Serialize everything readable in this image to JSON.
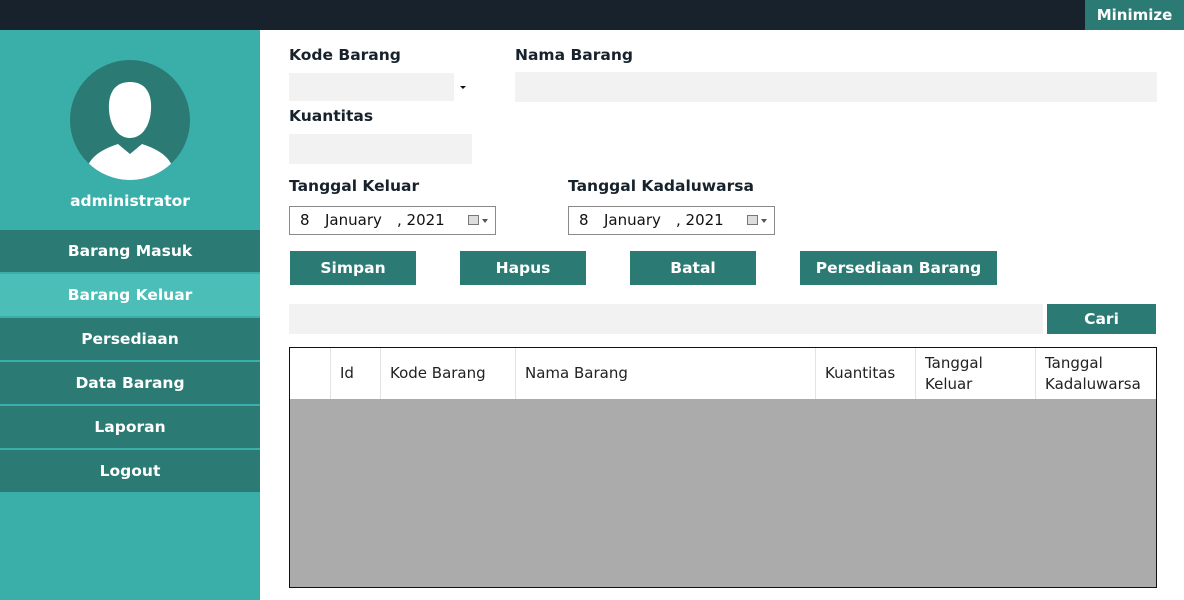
{
  "window": {
    "minimize_label": "Minimize"
  },
  "sidebar": {
    "username": "administrator",
    "items": [
      {
        "label": "Barang Masuk"
      },
      {
        "label": "Barang Keluar",
        "active": true
      },
      {
        "label": "Persediaan"
      },
      {
        "label": "Data Barang"
      },
      {
        "label": "Laporan"
      },
      {
        "label": "Logout"
      }
    ]
  },
  "form": {
    "kode_barang_label": "Kode Barang",
    "kode_barang_value": "",
    "nama_barang_label": "Nama Barang",
    "nama_barang_value": "",
    "kuantitas_label": "Kuantitas",
    "kuantitas_value": "",
    "tanggal_keluar_label": "Tanggal Keluar",
    "tanggal_keluar": {
      "day": "8",
      "month": "January",
      "year": ", 2021"
    },
    "tanggal_kadaluwarsa_label": "Tanggal Kadaluwarsa",
    "tanggal_kadaluwarsa": {
      "day": "8",
      "month": "January",
      "year": ", 2021"
    }
  },
  "buttons": {
    "simpan": "Simpan",
    "hapus": "Hapus",
    "batal": "Batal",
    "persediaan_barang": "Persediaan Barang",
    "cari": "Cari"
  },
  "search": {
    "value": ""
  },
  "table": {
    "columns": [
      "",
      "Id",
      "Kode Barang",
      "Nama Barang",
      "Kuantitas",
      "Tanggal Keluar",
      "Tanggal Kadaluwarsa"
    ],
    "rows": []
  },
  "colors": {
    "topbar": "#17222c",
    "sidebar": "#3aafa9",
    "accent": "#2b7a73",
    "active_nav": "#4bbfb7",
    "table_empty": "#ababab"
  }
}
